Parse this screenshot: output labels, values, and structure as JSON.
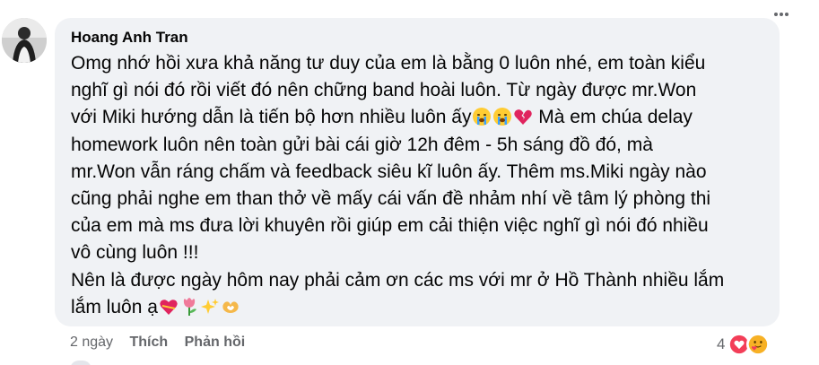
{
  "comment": {
    "author": "Hoang Anh Tran",
    "lines": [
      "Omg nhớ hồi xưa khả năng tư duy của em là bằng 0 luôn nhé, em toàn kiểu",
      "nghĩ gì nói đó rồi viết đó nên chững band hoài luôn. Từ ngày được mr.Won",
      "với Miki hướng dẫn là tiến bộ hơn nhiều luôn ấy",
      " Mà em chúa delay",
      "homework luôn nên toàn gửi bài cái giờ 12h đêm - 5h sáng đồ đó, mà",
      "mr.Won vẫn ráng chấm và feedback siêu kĩ luôn ấy. Thêm ms.Miki ngày nào",
      "cũng phải nghe em than thở về mấy cái vấn đề nhảm nhí về tâm lý phòng thi",
      "của em mà ms đưa lời khuyên rồi giúp em cải thiện việc nghĩ gì nói đó nhiều",
      "vô cùng luôn !!!",
      "Nên là được ngày hôm nay phải cảm ơn các ms với mr ở Hồ Thành nhiều lắm",
      "lắm luôn ạ"
    ],
    "emojis_line3": [
      "crying-face-emoji",
      "crying-face-emoji",
      "broken-heart-emoji"
    ],
    "emojis_last": [
      "heart-with-ribbon-emoji",
      "tulip-emoji",
      "sparkles-emoji",
      "heart-hands-emoji"
    ]
  },
  "actions": {
    "time": "2 ngày",
    "like": "Thích",
    "reply": "Phản hồi"
  },
  "reactions": {
    "count": "4",
    "icons": [
      "heart-reaction-icon",
      "care-reaction-icon"
    ]
  },
  "colors": {
    "bubble_bg": "#f0f2f5",
    "meta_text": "#65676b",
    "heart_red": "#f33e58",
    "care_yellow": "#f7b125"
  }
}
